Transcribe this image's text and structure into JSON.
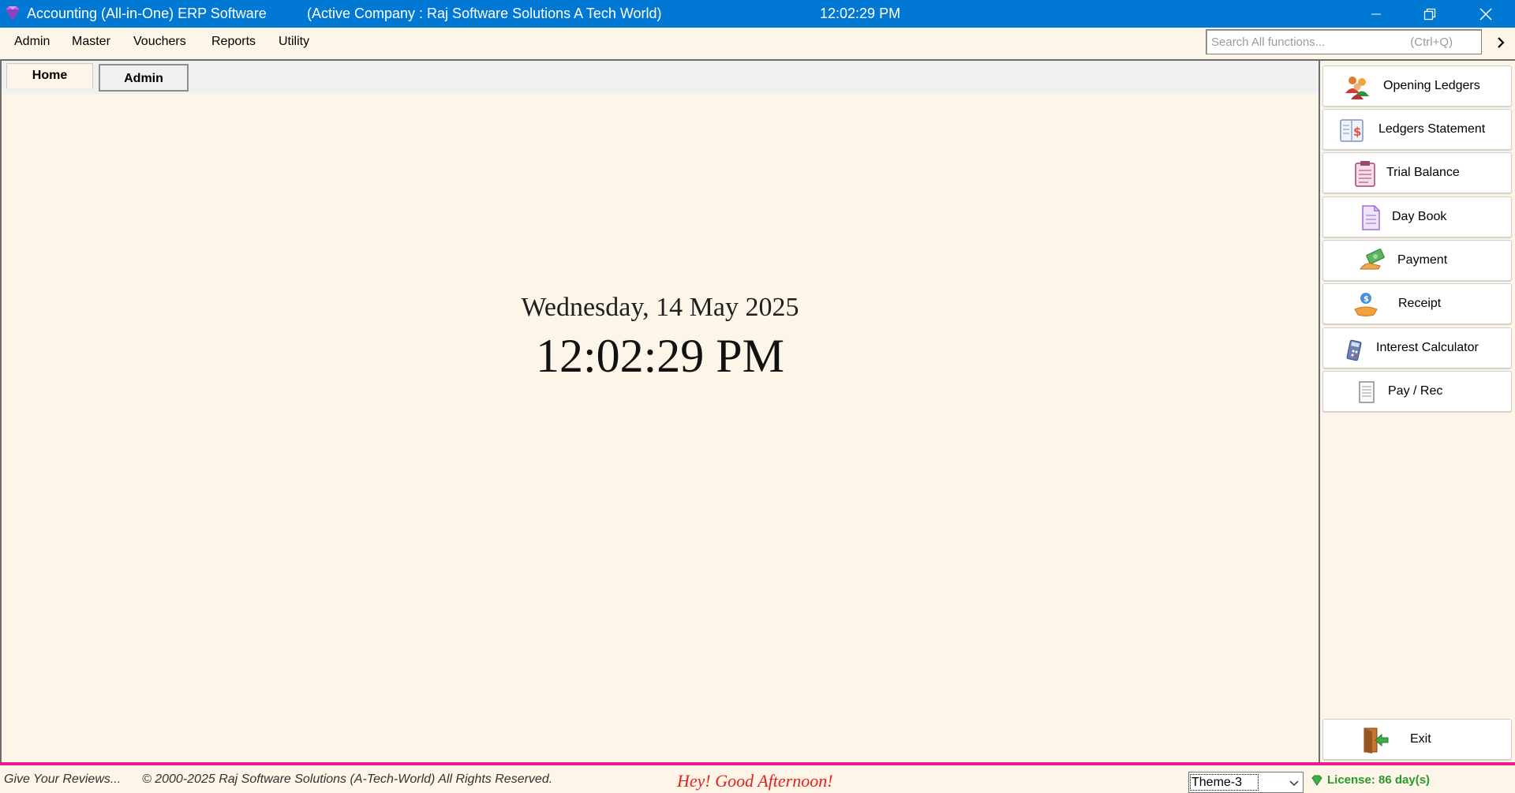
{
  "titlebar": {
    "app_title": "Accounting (All-in-One) ERP Software",
    "company": "(Active Company :  Raj Software Solutions A Tech World)",
    "clock": "12:02:29 PM",
    "icons": [
      "app-gem-icon",
      "minimize-icon",
      "restore-icon",
      "close-icon"
    ]
  },
  "menubar": {
    "items": [
      "Admin",
      "Master",
      "Vouchers",
      "Reports",
      "Utility"
    ],
    "search_placeholder": "Search All functions...",
    "search_hint": "(Ctrl+Q)"
  },
  "tabs": [
    "Home",
    "Admin"
  ],
  "main": {
    "date": "Wednesday, 14 May 2025",
    "time": "12:02:29 PM"
  },
  "quick_buttons": [
    {
      "label": "Opening Ledgers",
      "icon": "people-group-icon"
    },
    {
      "label": "Ledgers Statement",
      "icon": "ledger-dollar-icon"
    },
    {
      "label": "Trial Balance",
      "icon": "clipboard-icon"
    },
    {
      "label": "Day Book",
      "icon": "document-icon"
    },
    {
      "label": "Payment",
      "icon": "cash-hand-icon"
    },
    {
      "label": "Receipt",
      "icon": "coin-hand-icon"
    },
    {
      "label": "Interest Calculator",
      "icon": "calculator-icon"
    },
    {
      "label": "Pay / Rec",
      "icon": "page-icon"
    },
    {
      "label": "Exit",
      "icon": "exit-door-icon"
    }
  ],
  "statusbar": {
    "reviews": "Give Your Reviews...",
    "copyright": "© 2000-2025 Raj Software Solutions (A-Tech-World) All Rights Reserved.",
    "greeting": "Hey! Good Afternoon!",
    "theme": "Theme-3",
    "license": "License: 86 day(s)"
  },
  "colors": {
    "titlebar": "#0078d4",
    "background": "#fdf5e7",
    "status_accent": "#e91e8c",
    "greeting": "#e5201e",
    "license": "#2a9a2a"
  }
}
